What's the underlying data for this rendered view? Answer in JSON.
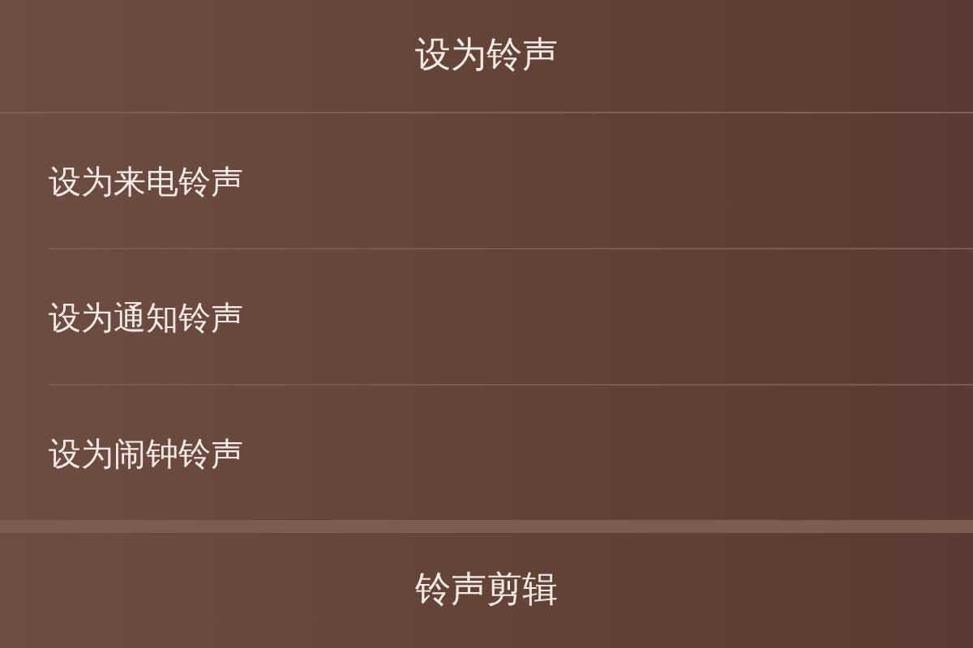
{
  "dialog": {
    "title": "设为铃声",
    "options": [
      {
        "label": "设为来电铃声"
      },
      {
        "label": "设为通知铃声"
      },
      {
        "label": "设为闹钟铃声"
      }
    ],
    "button": {
      "label": "铃声剪辑"
    }
  }
}
